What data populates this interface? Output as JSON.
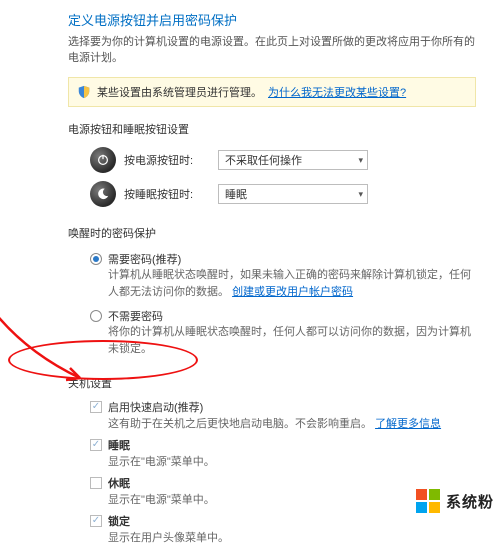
{
  "header": {
    "title": "定义电源按钮并启用密码保护",
    "desc": "选择要为你的计算机设置的电源设置。在此页上对设置所做的更改将应用于你所有的电源计划。"
  },
  "infobar": {
    "text": "某些设置由系统管理员进行管理。",
    "link": "为什么我无法更改某些设置?"
  },
  "buttons_section": {
    "head": "电源按钮和睡眠按钮设置",
    "power_label": "按电源按钮时:",
    "power_value": "不采取任何操作",
    "sleep_label": "按睡眠按钮时:",
    "sleep_value": "睡眠"
  },
  "wake_section": {
    "head": "唤醒时的密码保护",
    "req": {
      "label": "需要密码(推荐)",
      "desc_a": "计算机从睡眠状态唤醒时，如果未输入正确的密码来解除计算机锁定，任何人都无法访问你的数据。",
      "link": "创建或更改用户帐户密码"
    },
    "noreq": {
      "label": "不需要密码",
      "desc": "将你的计算机从睡眠状态唤醒时，任何人都可以访问你的数据，因为计算机未锁定。"
    }
  },
  "shutdown_section": {
    "head": "关机设置",
    "fast": {
      "label": "启用快速启动(推荐)",
      "desc_a": "这有助于在关机之后更快地启动电脑。不会影响重启。",
      "link": "了解更多信息"
    },
    "sleep": {
      "label": "睡眠",
      "desc": "显示在\"电源\"菜单中。"
    },
    "hibernate": {
      "label": "休眠",
      "desc": "显示在\"电源\"菜单中。"
    },
    "lock": {
      "label": "锁定",
      "desc": "显示在用户头像菜单中。"
    }
  },
  "watermark": {
    "text": "系统粉"
  }
}
